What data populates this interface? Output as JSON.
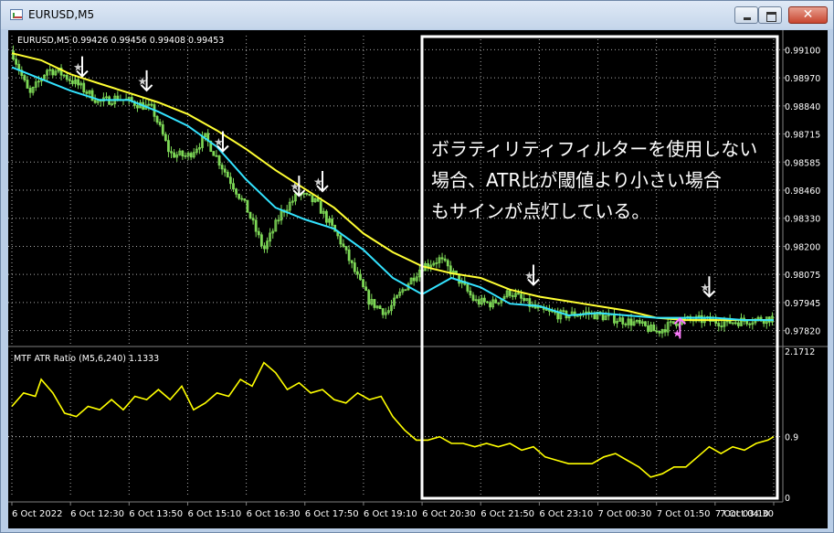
{
  "window": {
    "title": "EURUSD,M5",
    "close_glyph": "✕",
    "icons": [
      "chart-app-icon",
      "minimize-icon",
      "maximize-icon",
      "close-icon"
    ]
  },
  "colors": {
    "background": "#000000",
    "candles": "#7ed957",
    "ma_slow": "#ffff33",
    "ma_fast": "#33e3ff",
    "indicator": "#ffff00",
    "signal_sell": "#ffffff",
    "signal_buy": "#ff7bff",
    "text": "#ffffff",
    "grid": "#d8d8d8"
  },
  "chart_data": [
    {
      "type": "candlestick",
      "title": "EURUSD,M5 0.99426 0.99456 0.99408 0.99453",
      "symbol": "EURUSD,M5",
      "ohlc": {
        "open": 0.99426,
        "high": 0.99456,
        "low": 0.99408,
        "close": 0.99453
      },
      "ylim": [
        0.97815,
        0.99135
      ],
      "y_ticks": [
        "0.99100",
        "0.98970",
        "0.98840",
        "0.98715",
        "0.98585",
        "0.98460",
        "0.98330",
        "0.98200",
        "0.98075",
        "0.97945",
        "0.97820"
      ],
      "x_ticks": [
        "6 Oct 2022",
        "6 Oct 12:30",
        "6 Oct 13:50",
        "6 Oct 15:10",
        "6 Oct 16:30",
        "6 Oct 17:50",
        "6 Oct 19:10",
        "6 Oct 20:30",
        "6 Oct 21:50",
        "6 Oct 23:10",
        "7 Oct 00:30",
        "7 Oct 01:50",
        "7 Oct 03:10",
        "7 Oct 04:30"
      ],
      "x_range": [
        0,
        13
      ],
      "grid": true,
      "price_path": [
        [
          0,
          0.9907
        ],
        [
          0.3,
          0.9888
        ],
        [
          0.6,
          0.9899
        ],
        [
          0.8,
          0.9898
        ],
        [
          1.1,
          0.9893
        ],
        [
          1.5,
          0.9885
        ],
        [
          1.8,
          0.9887
        ],
        [
          2.2,
          0.9884
        ],
        [
          2.4,
          0.9882
        ],
        [
          2.7,
          0.9863
        ],
        [
          3.0,
          0.9862
        ],
        [
          3.3,
          0.987
        ],
        [
          3.6,
          0.9857
        ],
        [
          4.0,
          0.984
        ],
        [
          4.3,
          0.9822
        ],
        [
          4.6,
          0.9838
        ],
        [
          4.9,
          0.9846
        ],
        [
          5.2,
          0.9842
        ],
        [
          5.6,
          0.9826
        ],
        [
          5.9,
          0.981
        ],
        [
          6.1,
          0.98
        ],
        [
          6.4,
          0.9795
        ],
        [
          6.7,
          0.9806
        ],
        [
          7.0,
          0.9815
        ],
        [
          7.3,
          0.9818
        ],
        [
          7.6,
          0.981
        ],
        [
          7.9,
          0.98
        ],
        [
          8.2,
          0.9799
        ],
        [
          8.5,
          0.9804
        ],
        [
          8.8,
          0.9799
        ],
        [
          9.0,
          0.9796
        ],
        [
          9.4,
          0.9794
        ],
        [
          9.8,
          0.9795
        ],
        [
          10.2,
          0.9793
        ],
        [
          10.6,
          0.9791
        ],
        [
          11.0,
          0.9787
        ],
        [
          11.4,
          0.9792
        ],
        [
          11.8,
          0.9792
        ],
        [
          12.2,
          0.9791
        ],
        [
          12.6,
          0.9792
        ],
        [
          13.0,
          0.9793
        ]
      ],
      "ma_slow": [
        [
          0,
          0.9906
        ],
        [
          0.5,
          0.9903
        ],
        [
          1.0,
          0.9897
        ],
        [
          1.5,
          0.9893
        ],
        [
          2.0,
          0.9889
        ],
        [
          2.5,
          0.9885
        ],
        [
          3.0,
          0.988
        ],
        [
          3.5,
          0.9873
        ],
        [
          4.0,
          0.9865
        ],
        [
          4.5,
          0.9856
        ],
        [
          5.0,
          0.9848
        ],
        [
          5.5,
          0.984
        ],
        [
          6.0,
          0.9829
        ],
        [
          6.5,
          0.9821
        ],
        [
          7.0,
          0.9815
        ],
        [
          7.5,
          0.9812
        ],
        [
          8.0,
          0.981
        ],
        [
          8.5,
          0.9805
        ],
        [
          9.0,
          0.9802
        ],
        [
          9.5,
          0.98
        ],
        [
          10.0,
          0.9798
        ],
        [
          10.5,
          0.9796
        ],
        [
          11.0,
          0.9793
        ],
        [
          11.5,
          0.9792
        ],
        [
          12.0,
          0.9792
        ],
        [
          12.5,
          0.9792
        ],
        [
          13.0,
          0.9792
        ]
      ],
      "ma_fast": [
        [
          0,
          0.99
        ],
        [
          0.5,
          0.9895
        ],
        [
          1.0,
          0.989
        ],
        [
          1.5,
          0.9886
        ],
        [
          2.0,
          0.9886
        ],
        [
          2.5,
          0.9881
        ],
        [
          3.0,
          0.9875
        ],
        [
          3.5,
          0.9866
        ],
        [
          4.0,
          0.9852
        ],
        [
          4.5,
          0.984
        ],
        [
          5.0,
          0.9835
        ],
        [
          5.5,
          0.9831
        ],
        [
          6.0,
          0.9822
        ],
        [
          6.5,
          0.981
        ],
        [
          7.0,
          0.9803
        ],
        [
          7.5,
          0.981
        ],
        [
          8.0,
          0.9806
        ],
        [
          8.5,
          0.9799
        ],
        [
          9.0,
          0.9798
        ],
        [
          9.5,
          0.9794
        ],
        [
          10.0,
          0.9795
        ],
        [
          10.5,
          0.9794
        ],
        [
          11.0,
          0.9793
        ],
        [
          11.5,
          0.9793
        ],
        [
          12.0,
          0.9793
        ],
        [
          12.5,
          0.9792
        ],
        [
          13.0,
          0.9792
        ]
      ],
      "signals_sell": [
        [
          1.2,
          0.99
        ],
        [
          2.3,
          0.9894
        ],
        [
          3.6,
          0.9868
        ],
        [
          4.9,
          0.9849
        ],
        [
          5.3,
          0.9851
        ],
        [
          8.9,
          0.9811
        ],
        [
          11.9,
          0.9806
        ]
      ],
      "signals_buy": [
        [
          11.4,
          0.9788
        ]
      ]
    },
    {
      "type": "line",
      "title": "MTF ATR Ratio  (M5,6,240) 1.1333",
      "ylim": [
        0,
        2.1712
      ],
      "y_ticks": [
        "2.1712",
        "0.9",
        "0"
      ],
      "reference_line": 0.9,
      "x_range": [
        0,
        13
      ],
      "points": [
        [
          0,
          1.35
        ],
        [
          0.2,
          1.55
        ],
        [
          0.4,
          1.5
        ],
        [
          0.5,
          1.75
        ],
        [
          0.7,
          1.55
        ],
        [
          0.9,
          1.25
        ],
        [
          1.1,
          1.2
        ],
        [
          1.3,
          1.35
        ],
        [
          1.5,
          1.3
        ],
        [
          1.7,
          1.45
        ],
        [
          1.9,
          1.3
        ],
        [
          2.1,
          1.5
        ],
        [
          2.3,
          1.45
        ],
        [
          2.5,
          1.6
        ],
        [
          2.7,
          1.45
        ],
        [
          2.9,
          1.65
        ],
        [
          3.1,
          1.3
        ],
        [
          3.3,
          1.4
        ],
        [
          3.5,
          1.55
        ],
        [
          3.7,
          1.5
        ],
        [
          3.9,
          1.75
        ],
        [
          4.1,
          1.65
        ],
        [
          4.3,
          2.0
        ],
        [
          4.5,
          1.85
        ],
        [
          4.7,
          1.6
        ],
        [
          4.9,
          1.7
        ],
        [
          5.1,
          1.55
        ],
        [
          5.3,
          1.6
        ],
        [
          5.5,
          1.45
        ],
        [
          5.7,
          1.4
        ],
        [
          5.9,
          1.55
        ],
        [
          6.1,
          1.45
        ],
        [
          6.3,
          1.5
        ],
        [
          6.5,
          1.2
        ],
        [
          6.7,
          1.0
        ],
        [
          6.9,
          0.85
        ],
        [
          7.1,
          0.85
        ],
        [
          7.3,
          0.9
        ],
        [
          7.5,
          0.8
        ],
        [
          7.7,
          0.8
        ],
        [
          7.9,
          0.75
        ],
        [
          8.1,
          0.8
        ],
        [
          8.3,
          0.75
        ],
        [
          8.5,
          0.8
        ],
        [
          8.7,
          0.7
        ],
        [
          8.9,
          0.75
        ],
        [
          9.1,
          0.6
        ],
        [
          9.3,
          0.55
        ],
        [
          9.5,
          0.5
        ],
        [
          9.7,
          0.5
        ],
        [
          9.9,
          0.5
        ],
        [
          10.1,
          0.6
        ],
        [
          10.3,
          0.65
        ],
        [
          10.5,
          0.55
        ],
        [
          10.7,
          0.45
        ],
        [
          10.9,
          0.3
        ],
        [
          11.1,
          0.35
        ],
        [
          11.3,
          0.45
        ],
        [
          11.5,
          0.45
        ],
        [
          11.7,
          0.6
        ],
        [
          11.9,
          0.75
        ],
        [
          12.1,
          0.65
        ],
        [
          12.3,
          0.75
        ],
        [
          12.5,
          0.7
        ],
        [
          12.7,
          0.8
        ],
        [
          12.9,
          0.85
        ],
        [
          13.0,
          0.9
        ]
      ]
    }
  ],
  "annotation": {
    "lines": [
      "ボラティリティフィルターを使用しない",
      "場合、ATR比が閾値より小さい場合",
      "もサインが点灯している。"
    ]
  }
}
